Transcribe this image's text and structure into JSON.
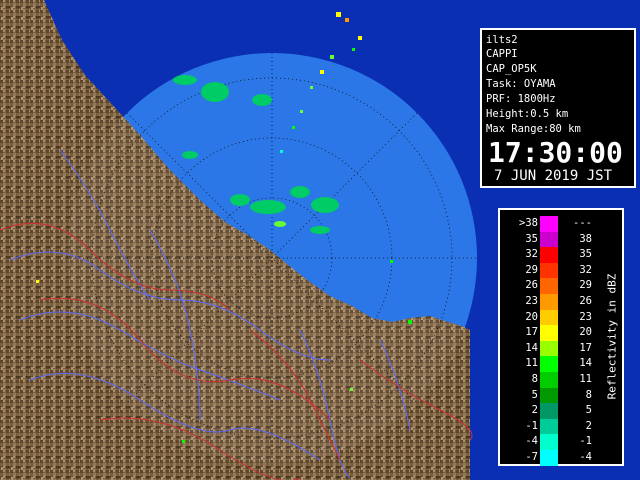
{
  "info": {
    "station": "ilts2",
    "product": "CAPPI",
    "code": "CAP_OP5K",
    "task": "Task: OYAMA",
    "prf": "PRF: 1800Hz",
    "height": "Height:0.5 km",
    "max_range": "Max Range:80 km",
    "time": "17:30:00",
    "date": "7 JUN 2019 JST"
  },
  "legend": {
    "unit_label": "Reflectivity in dBZ",
    "rows": [
      {
        "low": ">38",
        "high": "---",
        "color": "#ff00ff"
      },
      {
        "low": "35",
        "high": "38",
        "color": "#cc00cc"
      },
      {
        "low": "32",
        "high": "35",
        "color": "#ff0000"
      },
      {
        "low": "29",
        "high": "32",
        "color": "#ff3300"
      },
      {
        "low": "26",
        "high": "29",
        "color": "#ff6600"
      },
      {
        "low": "23",
        "high": "26",
        "color": "#ff9900"
      },
      {
        "low": "20",
        "high": "23",
        "color": "#ffcc00"
      },
      {
        "low": "17",
        "high": "20",
        "color": "#ffff00"
      },
      {
        "low": "14",
        "high": "17",
        "color": "#99ff00"
      },
      {
        "low": "11",
        "high": "14",
        "color": "#00ff00"
      },
      {
        "low": "8",
        "high": "11",
        "color": "#00cc00"
      },
      {
        "low": "5",
        "high": "8",
        "color": "#009900"
      },
      {
        "low": "2",
        "high": "5",
        "color": "#009966"
      },
      {
        "low": "-1",
        "high": "2",
        "color": "#00cc99"
      },
      {
        "low": "-4",
        "high": "-1",
        "color": "#00ffcc"
      },
      {
        "low": "-7",
        "high": "-4",
        "color": "#00ffff"
      }
    ]
  },
  "map": {
    "sea_color": "#1f6fe6",
    "sea_dark_color": "#0a2fb3",
    "land_color": "#7a5f3e",
    "river_color": "#5a6aff",
    "boundary_color": "#d03030",
    "echo_colors": [
      "#00cc66",
      "#00ff00",
      "#66ff33",
      "#ffff00",
      "#ff9900",
      "#00ffcc"
    ]
  }
}
